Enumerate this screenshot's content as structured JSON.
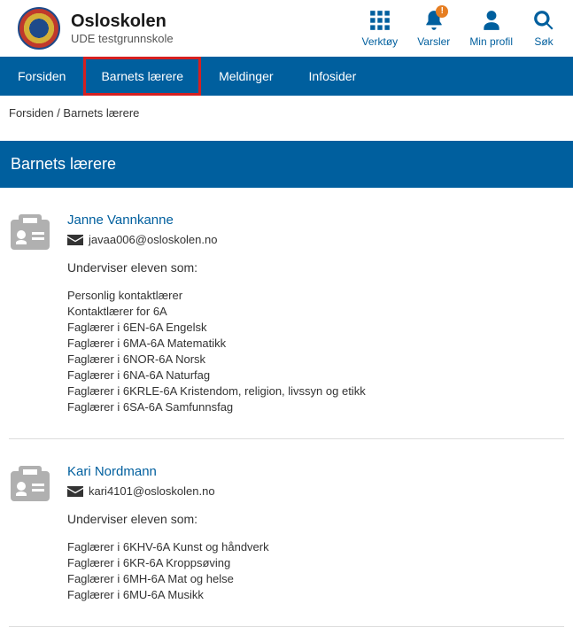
{
  "header": {
    "title": "Osloskolen",
    "subtitle": "UDE testgrunnskole",
    "tools": [
      {
        "label": "Verktøy",
        "icon": "grid",
        "name": "tools-button"
      },
      {
        "label": "Varsler",
        "icon": "bell",
        "name": "alerts-button",
        "alert": "!"
      },
      {
        "label": "Min profil",
        "icon": "user",
        "name": "profile-button"
      },
      {
        "label": "Søk",
        "icon": "search",
        "name": "search-button"
      }
    ]
  },
  "nav": [
    {
      "label": "Forsiden",
      "name": "nav-forsiden",
      "highlighted": false
    },
    {
      "label": "Barnets lærere",
      "name": "nav-barnets-laerere",
      "highlighted": true
    },
    {
      "label": "Meldinger",
      "name": "nav-meldinger",
      "highlighted": false
    },
    {
      "label": "Infosider",
      "name": "nav-infosider",
      "highlighted": false
    }
  ],
  "breadcrumb": "Forsiden / Barnets lærere",
  "page_title": "Barnets lærere",
  "teaches_heading": "Underviser eleven som:",
  "teachers": [
    {
      "name": "Janne Vannkanne",
      "email": "javaa006@osloskolen.no",
      "roles": [
        "Personlig kontaktlærer",
        "Kontaktlærer for 6A",
        "Faglærer i 6EN-6A Engelsk",
        "Faglærer i 6MA-6A Matematikk",
        "Faglærer i 6NOR-6A Norsk",
        "Faglærer i 6NA-6A Naturfag",
        "Faglærer i 6KRLE-6A Kristendom, religion, livssyn og etikk",
        "Faglærer i 6SA-6A Samfunnsfag"
      ]
    },
    {
      "name": "Kari Nordmann",
      "email": "kari4101@osloskolen.no",
      "roles": [
        "Faglærer i 6KHV-6A Kunst og håndverk",
        "Faglærer i 6KR-6A Kroppsøving",
        "Faglærer i 6MH-6A Mat og helse",
        "Faglærer i 6MU-6A Musikk"
      ]
    }
  ]
}
